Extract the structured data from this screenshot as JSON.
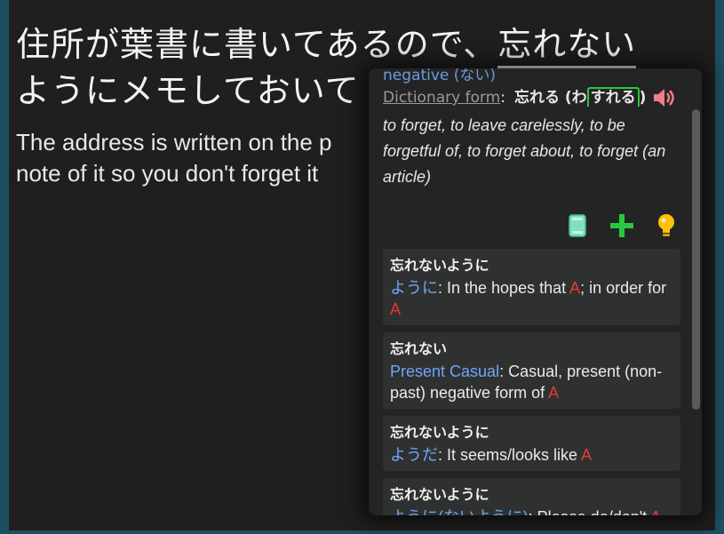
{
  "sentence": {
    "jp_before": "住所が葉書に書いてあるので、",
    "jp_highlight": "忘れない",
    "jp_after": "ように",
    "jp_line2": "ようにメモしておいて",
    "en": "The address is written on the p",
    "en_line2": "note of it so you don't forget it"
  },
  "popup": {
    "form_name": "negative (ない)",
    "dict_label": "Dictionary form",
    "dict_colon": ":",
    "dict_word": "忘れる",
    "reading_open": "(わ",
    "reading_boxed": "すれる",
    "reading_close": ")",
    "definition": "to forget, to leave carelessly, to be forgetful of, to forget about, to forget (an article)",
    "actions": [
      "book-icon",
      "plus-icon",
      "lightbulb-icon"
    ],
    "cards": [
      {
        "title": "忘れないように",
        "grammar": "ように",
        "text": ": In the hopes that ",
        "ph1": "A",
        "text2": "; in order for ",
        "ph2": "A"
      },
      {
        "title": "忘れない",
        "grammar": "Present Casual",
        "text": ": Casual, present (non-past) negative form of ",
        "ph1": "A",
        "text2": "",
        "ph2": ""
      },
      {
        "title": "忘れないように",
        "grammar": "ようだ",
        "text": ": It seems/looks like ",
        "ph1": "A",
        "text2": "",
        "ph2": ""
      },
      {
        "title": "忘れないように",
        "grammar": "ように(ないように)",
        "text": ": Please do/don't ",
        "ph1": "A",
        "text2": "",
        "ph2": ""
      }
    ]
  },
  "colors": {
    "accent": "#6b9be0",
    "placeholder": "#e8383a",
    "selection": "#27c93f",
    "speaker": "#f07c84"
  }
}
